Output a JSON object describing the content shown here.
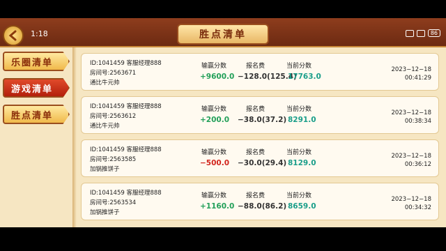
{
  "statusbar": {
    "clock": "1:18",
    "battery": "86"
  },
  "header": {
    "title": "胜点清单"
  },
  "sidebar": {
    "items": [
      {
        "label": "乐圈清单",
        "active": false
      },
      {
        "label": "游戏清单",
        "active": true
      },
      {
        "label": "胜点清单",
        "active": false
      }
    ]
  },
  "columns": {
    "win_loss": "输赢分数",
    "fee": "报名费",
    "current": "当前分数"
  },
  "records": [
    {
      "id": "ID:1041459  客服经理888",
      "room": "房间号:2563671",
      "name": "通比牛元帅",
      "win_loss": "+9600.0",
      "win_sign": "pos",
      "fee": "−128.0(125.4)",
      "current": "17763.0",
      "date": "2023−12−18",
      "time": "00:41:29"
    },
    {
      "id": "ID:1041459  客服经理888",
      "room": "房间号:2563612",
      "name": "通比牛元帅",
      "win_loss": "+200.0",
      "win_sign": "pos",
      "fee": "−38.0(37.2)",
      "current": "8291.0",
      "date": "2023−12−18",
      "time": "00:38:34"
    },
    {
      "id": "ID:1041459  客服经理888",
      "room": "房间号:2563585",
      "name": "加锅推饼子",
      "win_loss": "−500.0",
      "win_sign": "neg",
      "fee": "−30.0(29.4)",
      "current": "8129.0",
      "date": "2023−12−18",
      "time": "00:36:12"
    },
    {
      "id": "ID:1041459  客服经理888",
      "room": "房间号:2563534",
      "name": "加锅推饼子",
      "win_loss": "+1160.0",
      "win_sign": "pos",
      "fee": "−88.0(86.2)",
      "current": "8659.0",
      "date": "2023−12−18",
      "time": "00:34:32"
    }
  ]
}
